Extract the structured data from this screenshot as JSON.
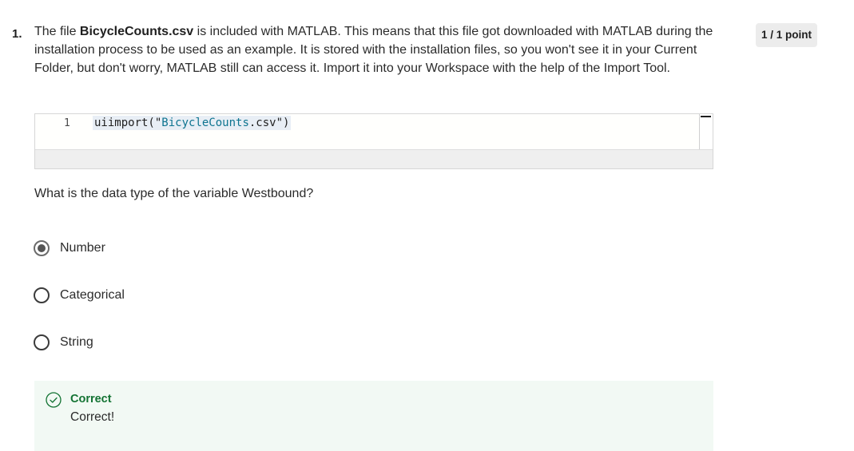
{
  "question": {
    "number": "1.",
    "text_parts": {
      "before": "The file ",
      "filename": "BicycleCounts.csv",
      "after": " is included with MATLAB. This means that this file got downloaded with MATLAB during the installation process to be used as an example. It is stored with the installation files, so you won't see it in your Current Folder, but don't worry, MATLAB still can access it. Import it into your Workspace with the help of the Import Tool."
    },
    "points": "1 / 1 point"
  },
  "code": {
    "line_number": "1",
    "fn": "uiimport(\"",
    "str": "BicycleCounts",
    "tail": ".csv\")"
  },
  "prompt": "What is the data type of the variable Westbound?",
  "options": [
    {
      "label": "Number",
      "selected": true
    },
    {
      "label": "Categorical",
      "selected": false
    },
    {
      "label": "String",
      "selected": false
    }
  ],
  "feedback": {
    "title": "Correct",
    "text": "Correct!",
    "color": "#137333"
  }
}
